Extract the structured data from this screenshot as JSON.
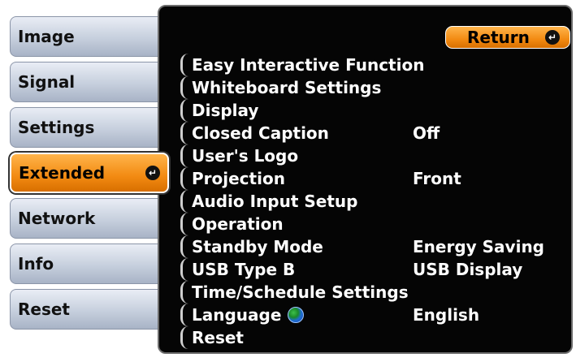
{
  "tabs": [
    {
      "label": "Image"
    },
    {
      "label": "Signal"
    },
    {
      "label": "Settings"
    },
    {
      "label": "Extended"
    },
    {
      "label": "Network"
    },
    {
      "label": "Info"
    },
    {
      "label": "Reset"
    }
  ],
  "active_tab": "Extended",
  "return_label": "Return",
  "colors": {
    "accent": "#f28a12",
    "panel_bg": "#050505",
    "tab_bg": "#c6cfdd",
    "menu_text": "#ffffff"
  },
  "icons": {
    "enter": "enter-arrow-icon",
    "language": "globe-icon"
  },
  "menu": [
    {
      "label": "Easy Interactive Function",
      "value": ""
    },
    {
      "label": "Whiteboard Settings",
      "value": ""
    },
    {
      "label": "Display",
      "value": ""
    },
    {
      "label": "Closed Caption",
      "value": "Off"
    },
    {
      "label": "User's Logo",
      "value": ""
    },
    {
      "label": "Projection",
      "value": "Front"
    },
    {
      "label": "Audio Input Setup",
      "value": ""
    },
    {
      "label": "Operation",
      "value": ""
    },
    {
      "label": "Standby Mode",
      "value": "Energy Saving"
    },
    {
      "label": "USB Type B",
      "value": "USB Display"
    },
    {
      "label": "Time/Schedule Settings",
      "value": ""
    },
    {
      "label": "Language",
      "value": "English"
    },
    {
      "label": "Reset",
      "value": ""
    }
  ]
}
